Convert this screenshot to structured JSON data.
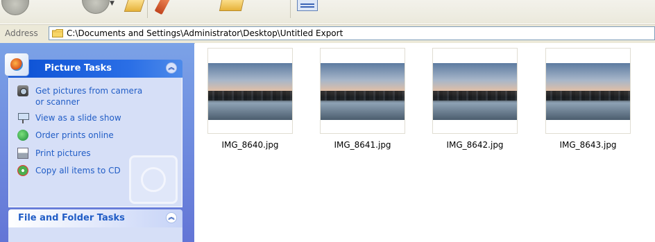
{
  "address_bar": {
    "label": "Address",
    "path": "C:\\Documents and Settings\\Administrator\\Desktop\\Untitled Export"
  },
  "picture_tasks": {
    "title": "Picture Tasks",
    "items": [
      {
        "label": "Get pictures from camera or scanner",
        "icon": "camera-icon"
      },
      {
        "label": "View as a slide show",
        "icon": "slideshow-icon"
      },
      {
        "label": "Order prints online",
        "icon": "order-prints-icon"
      },
      {
        "label": "Print pictures",
        "icon": "printer-icon"
      },
      {
        "label": "Copy all items to CD",
        "icon": "cd-icon"
      }
    ]
  },
  "file_folder_tasks": {
    "title": "File and Folder Tasks"
  },
  "files": [
    {
      "name": "IMG_8640.jpg"
    },
    {
      "name": "IMG_8641.jpg"
    },
    {
      "name": "IMG_8642.jpg"
    },
    {
      "name": "IMG_8643.jpg"
    }
  ],
  "colors": {
    "taskpane_gradient_top": "#7ba2e7",
    "taskpane_gradient_bottom": "#6375d6",
    "link_blue": "#215dc6"
  }
}
